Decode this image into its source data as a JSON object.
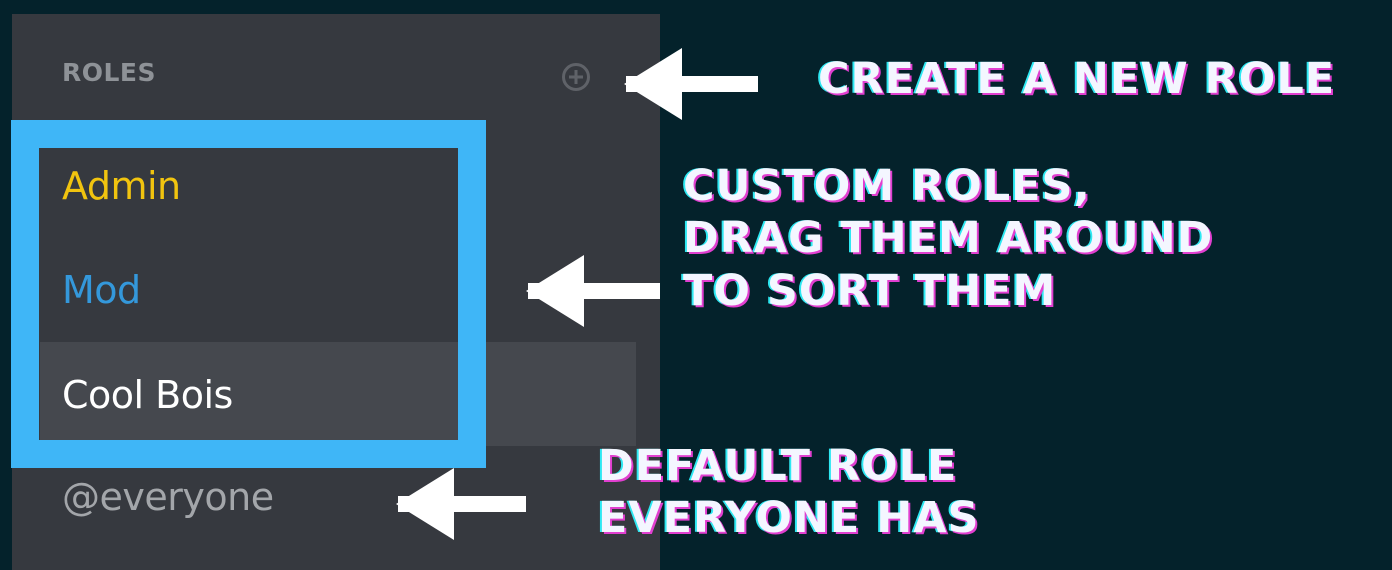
{
  "roles_panel": {
    "header": "ROLES",
    "add_icon": "plus-circle-icon",
    "roles": [
      {
        "label": "Admin",
        "color": "#f1c40f"
      },
      {
        "label": "Mod",
        "color": "#3498db"
      },
      {
        "label": "Cool Bois",
        "color": "#ffffff"
      },
      {
        "label": "@everyone",
        "color": "#a3a6aa"
      }
    ]
  },
  "annotations": {
    "create": "CREATE A NEW ROLE",
    "custom_lines": [
      "CUSTOM ROLES,",
      "DRAG THEM AROUND",
      "TO SORT THEM"
    ],
    "default_lines": [
      "DEFAULT ROLE",
      "EVERYONE HAS"
    ]
  },
  "colors": {
    "background": "#04222b",
    "panel": "#36393f",
    "highlight": "#3fb6f7",
    "annotation_text": "#f4f6ff"
  }
}
